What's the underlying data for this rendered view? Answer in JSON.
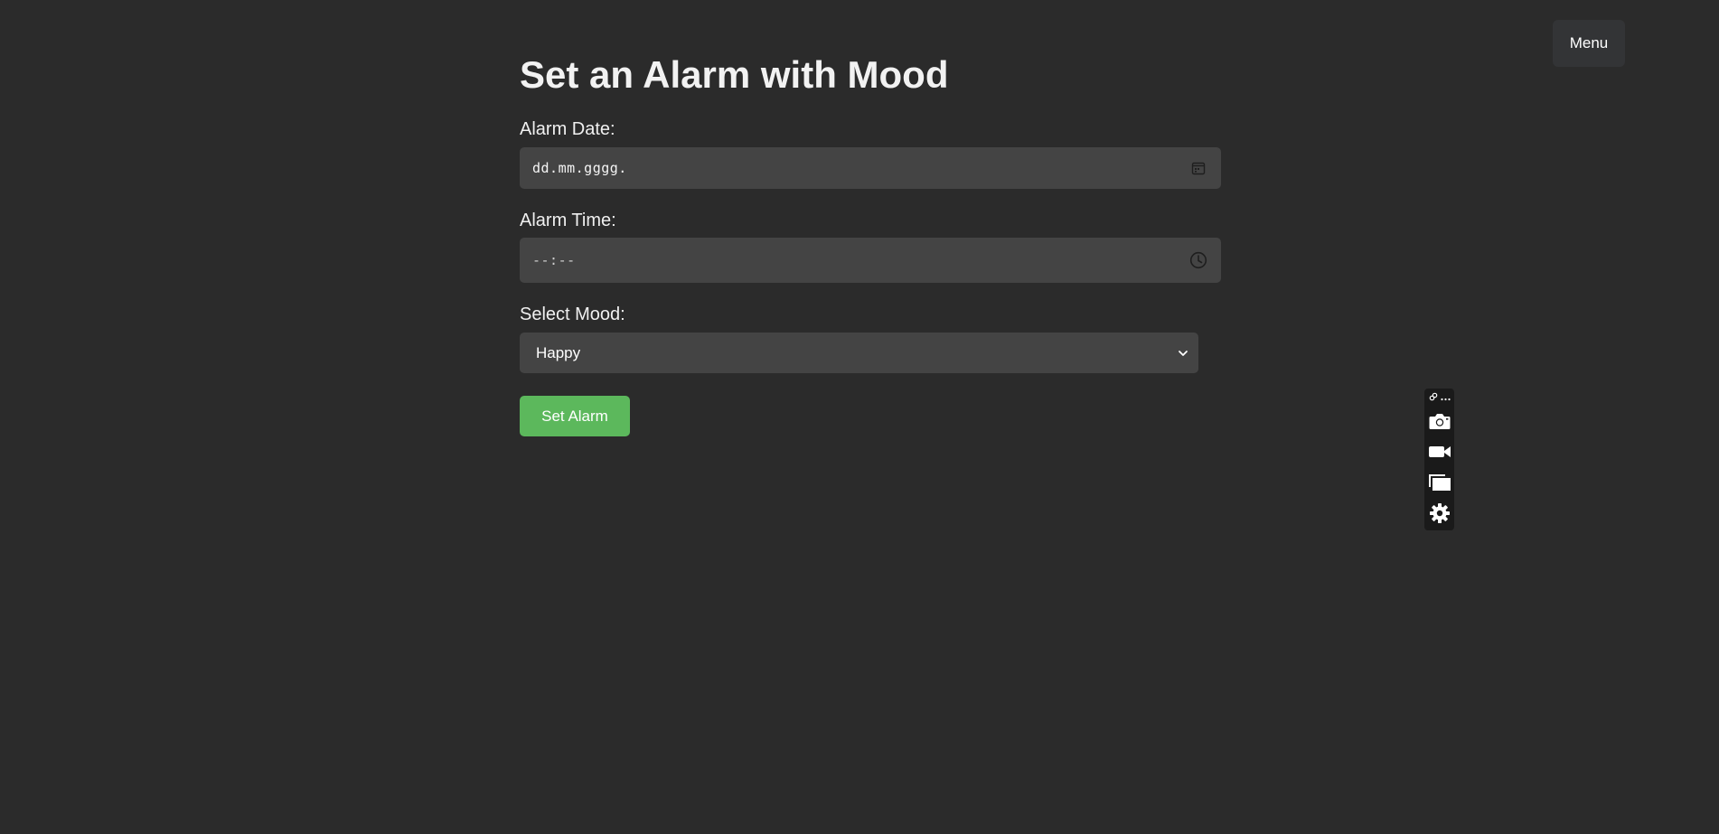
{
  "header": {
    "menu_label": "Menu"
  },
  "form": {
    "title": "Set an Alarm with Mood",
    "date": {
      "label": "Alarm Date:",
      "placeholder": "dd.mm.gggg.",
      "icon": "calendar-icon"
    },
    "time": {
      "label": "Alarm Time:",
      "placeholder": "--:--",
      "icon": "clock-icon"
    },
    "mood": {
      "label": "Select Mood:",
      "selected": "Happy",
      "icon": "chevron-down-icon"
    },
    "submit_label": "Set Alarm"
  },
  "toolbar": {
    "icons": [
      "link-icon",
      "more-icon",
      "camera-icon",
      "video-camera-icon",
      "windows-icon",
      "gear-icon"
    ]
  },
  "colors": {
    "background": "#2b2b2b",
    "input_background": "#444444",
    "accent_green": "#5cb85c",
    "menu_background": "#333436",
    "toolbar_background": "#1a1a1a"
  }
}
